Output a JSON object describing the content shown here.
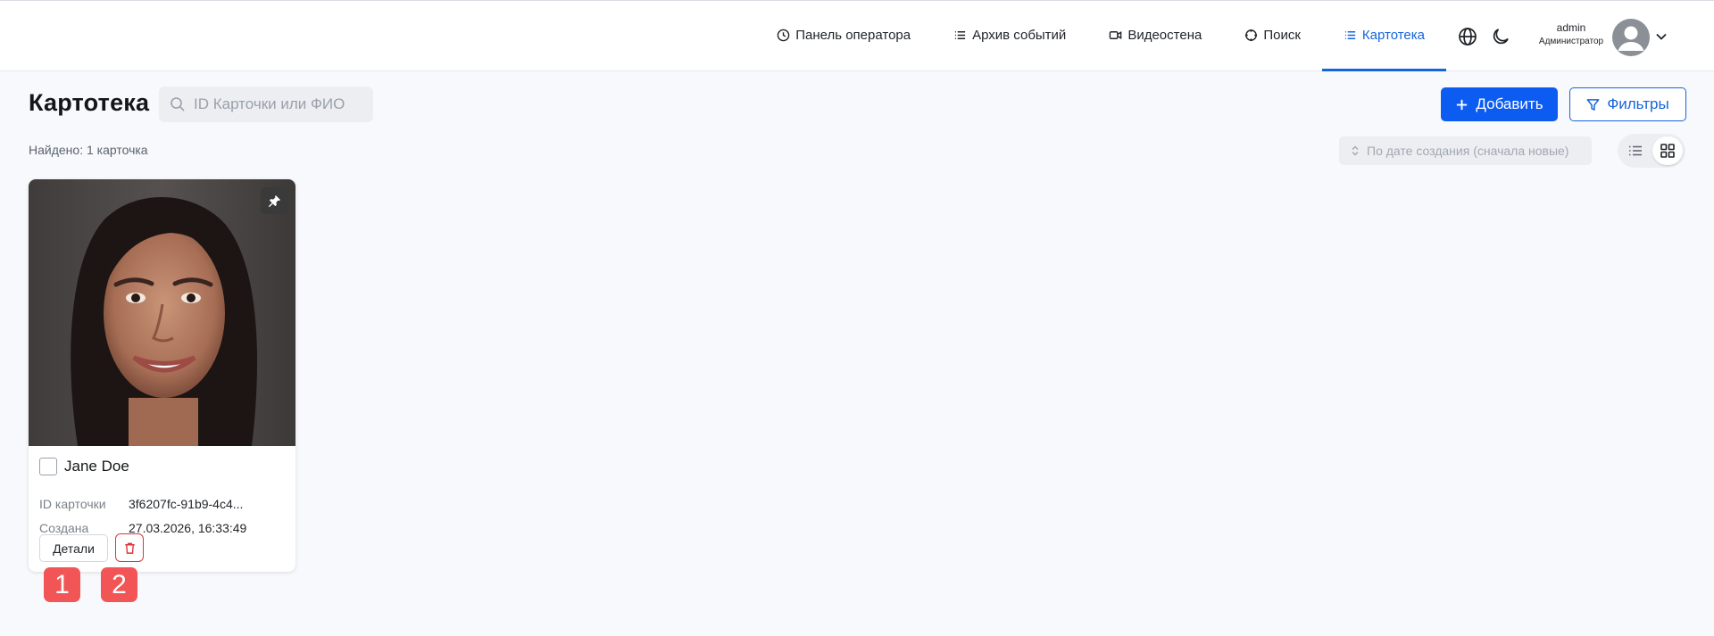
{
  "nav": {
    "items": [
      {
        "label": "Панель оператора",
        "icon": "clock-icon",
        "active": false
      },
      {
        "label": "Архив событий",
        "icon": "list-icon",
        "active": false
      },
      {
        "label": "Видеостена",
        "icon": "video-icon",
        "active": false
      },
      {
        "label": "Поиск",
        "icon": "crosshair-icon",
        "active": false
      },
      {
        "label": "Картотека",
        "icon": "list-icon",
        "active": true
      }
    ],
    "language_icon": "globe-icon",
    "theme_icon": "moon-icon"
  },
  "user": {
    "name": "admin",
    "role": "Администратор"
  },
  "page": {
    "title": "Картотека",
    "search_placeholder": "ID Карточки или ФИО",
    "add_label": "Добавить",
    "filters_label": "Фильтры",
    "found_text": "Найдено: 1 карточка",
    "sort_label": "По дате создания (сначала новые)",
    "view_mode": "grid"
  },
  "cards": [
    {
      "name": "Jane Doe",
      "id_label": "ID карточки",
      "id_value": "3f6207fc-91b9-4c4...",
      "created_label": "Создана",
      "created_value": "27.03.2026, 16:33:49",
      "details_label": "Детали"
    }
  ],
  "markers": [
    "1",
    "2"
  ],
  "colors": {
    "primary": "#0d5cf2",
    "active_nav": "#1565d8",
    "danger": "#e0353a",
    "marker": "#f25555",
    "background": "#f7f9fc"
  }
}
